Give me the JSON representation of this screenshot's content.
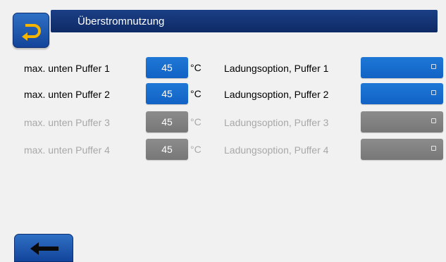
{
  "header": {
    "title": "Überstromnutzung",
    "back_icon": "return-arrow-icon"
  },
  "rows": [
    {
      "label": "max. unten Puffer 1",
      "value": "45",
      "unit": "°C",
      "option_label": "Ladungsoption, Puffer 1",
      "enabled": true
    },
    {
      "label": "max. unten Puffer 2",
      "value": "45",
      "unit": "°C",
      "option_label": "Ladungsoption, Puffer 2",
      "enabled": true
    },
    {
      "label": "max. unten Puffer 3",
      "value": "45",
      "unit": "°C",
      "option_label": "Ladungsoption, Puffer 3",
      "enabled": false
    },
    {
      "label": "max. unten Puffer 4",
      "value": "45",
      "unit": "°C",
      "option_label": "Ladungsoption, Puffer 4",
      "enabled": false
    }
  ],
  "footer": {
    "back_icon": "left-arrow-icon"
  },
  "colors": {
    "accent": "#1a6fd0",
    "header": "#14367a",
    "disabled": "#808080"
  }
}
